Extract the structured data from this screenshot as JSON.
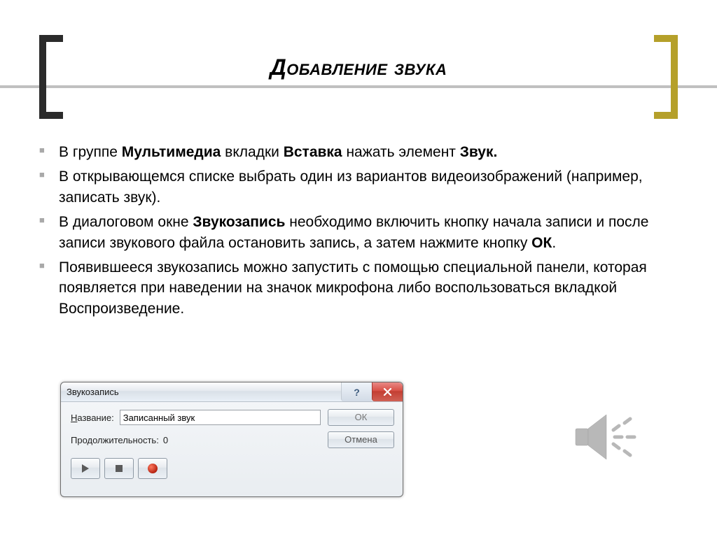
{
  "title": "Добавление звука",
  "bullets": [
    {
      "parts": [
        {
          "t": "В группе ",
          "b": false
        },
        {
          "t": "Мультимедиа",
          "b": true
        },
        {
          "t": " вкладки ",
          "b": false
        },
        {
          "t": "Вставка",
          "b": true
        },
        {
          "t": " нажать элемент ",
          "b": false
        },
        {
          "t": "Звук.",
          "b": true
        }
      ]
    },
    {
      "parts": [
        {
          "t": "В открывающемся списке выбрать один из вариантов видеоизображений (например, записать звук).",
          "b": false
        }
      ]
    },
    {
      "parts": [
        {
          "t": "В диалоговом окне ",
          "b": false
        },
        {
          "t": "Звукозапись",
          "b": true
        },
        {
          "t": " необходимо включить кнопку начала записи и после записи звукового файла остановить запись, а затем нажмите кнопку ",
          "b": false
        },
        {
          "t": "ОК",
          "b": true
        },
        {
          "t": ".",
          "b": false
        }
      ]
    },
    {
      "parts": [
        {
          "t": "Появившееся звукозапись можно запустить с помощью специальной панели, которая появляется при наведении на значок микрофона либо воспользоваться вкладкой Воспроизведение.",
          "b": false
        }
      ]
    }
  ],
  "dialog": {
    "title": "Звукозапись",
    "name_label_prefix": "Н",
    "name_label_rest": "азвание:",
    "name_value": "Записанный звук",
    "duration_label": "Продолжительность:",
    "duration_value": "0",
    "ok": "ОК",
    "cancel": "Отмена",
    "help": "?"
  }
}
